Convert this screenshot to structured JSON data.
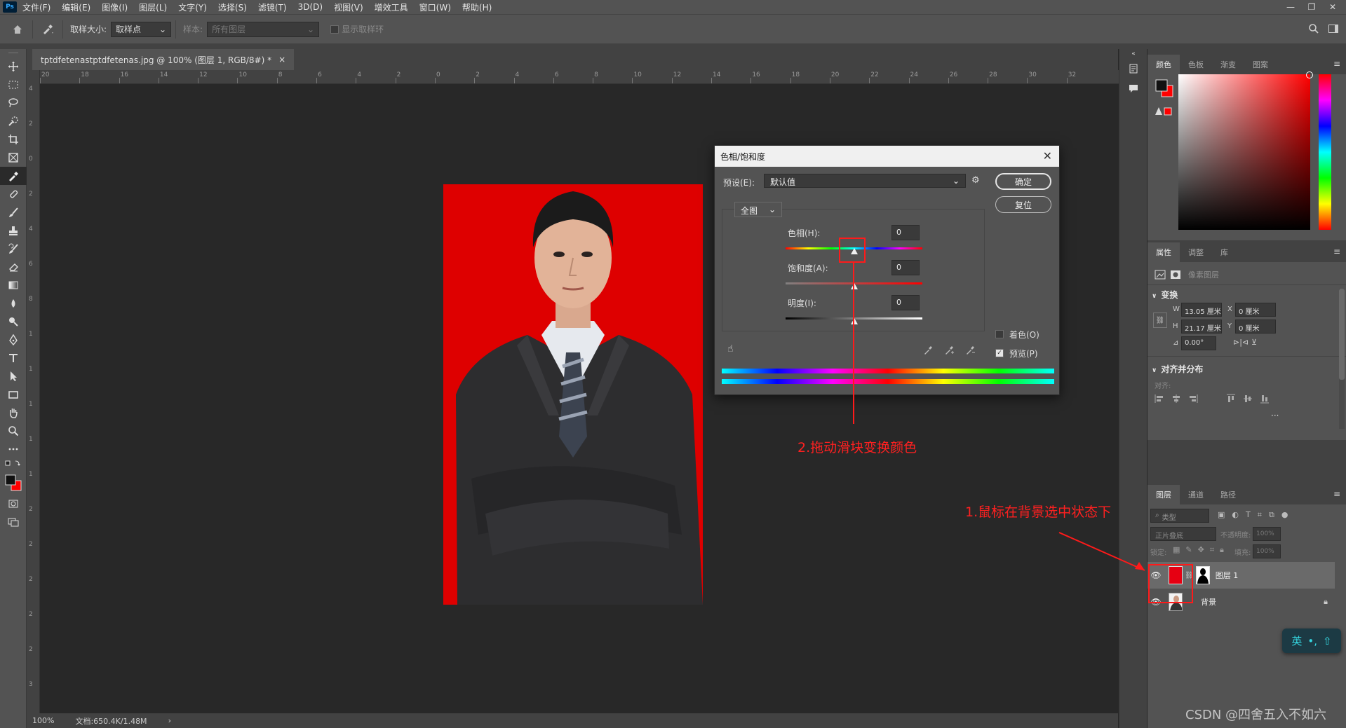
{
  "app": {
    "logo": "Ps",
    "menu": [
      "文件(F)",
      "编辑(E)",
      "图像(I)",
      "图层(L)",
      "文字(Y)",
      "选择(S)",
      "滤镜(T)",
      "3D(D)",
      "视图(V)",
      "增效工具",
      "窗口(W)",
      "帮助(H)"
    ],
    "window_controls": [
      "—",
      "❐",
      "✕"
    ]
  },
  "options": {
    "sample_size_label": "取样大小:",
    "sample_size_value": "取样点",
    "sample_label": "样本:",
    "sample_value": "所有图层",
    "show_ring_label": "显示取样环"
  },
  "document": {
    "tab_title": "tptdfetenastptdfetenas.jpg @ 100% (图层 1, RGB/8#) *",
    "tab_close": "×",
    "zoom": "100%",
    "doc_info": "文档:650.4K/1.48M",
    "status_arrow": "›"
  },
  "ruler": {
    "h_labels": [
      "20",
      "18",
      "16",
      "14",
      "12",
      "10",
      "8",
      "6",
      "4",
      "2",
      "0",
      "2",
      "4",
      "6",
      "8",
      "10",
      "12",
      "14",
      "16",
      "18",
      "20",
      "22",
      "24",
      "26",
      "28",
      "30",
      "32"
    ],
    "v_labels": [
      "4",
      "2",
      "0",
      "2",
      "4",
      "6",
      "8",
      "1",
      "1",
      "1",
      "1",
      "1",
      "2",
      "2",
      "2",
      "2",
      "2",
      "3"
    ]
  },
  "dialog": {
    "title": "色相/饱和度",
    "close": "✕",
    "preset_label": "预设(E):",
    "preset_value": "默认值",
    "ok": "确定",
    "reset": "复位",
    "channel": "全图",
    "hue_label": "色相(H):",
    "hue_value": "0",
    "sat_label": "饱和度(A):",
    "sat_value": "0",
    "light_label": "明度(I):",
    "light_value": "0",
    "colorize_label": "着色(O)",
    "preview_label": "预览(P)",
    "hue_position": 0.5,
    "sat_position": 0.5,
    "light_position": 0.5
  },
  "color_panel": {
    "tabs": [
      "颜色",
      "色板",
      "渐变",
      "图案"
    ]
  },
  "properties_panel": {
    "tabs": [
      "属性",
      "调整",
      "库"
    ],
    "pixel_layer": "像素图层",
    "transform_title": "变换",
    "w_label": "W",
    "w_value": "13.05 厘米",
    "h_label": "H",
    "h_value": "21.17 厘米",
    "x_label": "X",
    "x_value": "0 厘米",
    "y_label": "Y",
    "y_value": "0 厘米",
    "angle_value": "0.00°",
    "align_title": "对齐并分布",
    "align_label": "对齐:",
    "more": "···"
  },
  "layers_panel": {
    "tabs": [
      "图层",
      "通道",
      "路径"
    ],
    "filter_label": "类型",
    "blend_mode": "正片叠底",
    "opacity_label": "不透明度:",
    "opacity_value": "100%",
    "lock_label": "锁定:",
    "fill_label": "填充:",
    "fill_value": "100%",
    "layers": [
      {
        "name": "图层 1",
        "selected": true
      },
      {
        "name": "背景",
        "selected": false
      }
    ]
  },
  "annotations": {
    "step1": "1.鼠标在背景选中状态下",
    "step2": "2.拖动滑块变换颜色"
  },
  "ime": {
    "lang": "英",
    "punct": "•,",
    "shift": "⇧"
  },
  "watermark": "CSDN @四舍五入不如六",
  "colors": {
    "accent_red": "#ff1a1a",
    "photo_bg": "#de0000",
    "ui_dark": "#535353"
  }
}
